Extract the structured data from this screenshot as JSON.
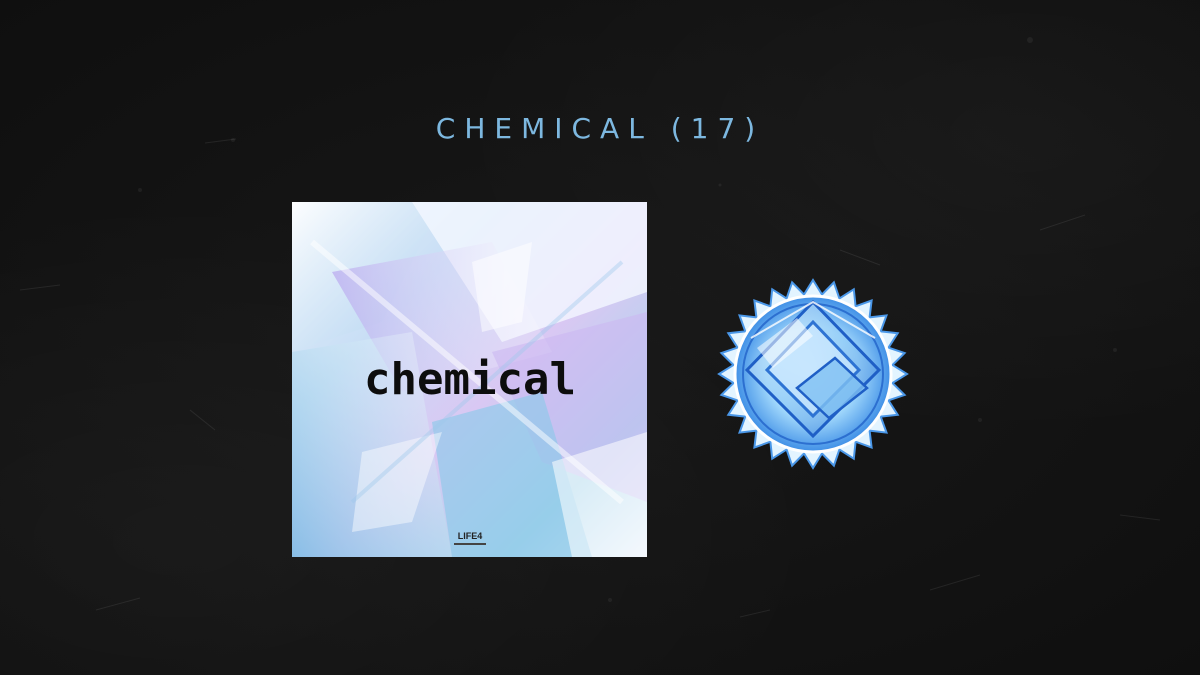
{
  "title": "CHEMICAL (17)",
  "cover": {
    "logo_text": "chemical",
    "label_text": "LIFE4",
    "icon": "album-cover-art"
  },
  "badge": {
    "icon": "diamond-rank-badge-icon",
    "colors": {
      "outer": "#3f8fe6",
      "inner": "#9fd6fb",
      "highlight": "#e8f7ff"
    }
  }
}
